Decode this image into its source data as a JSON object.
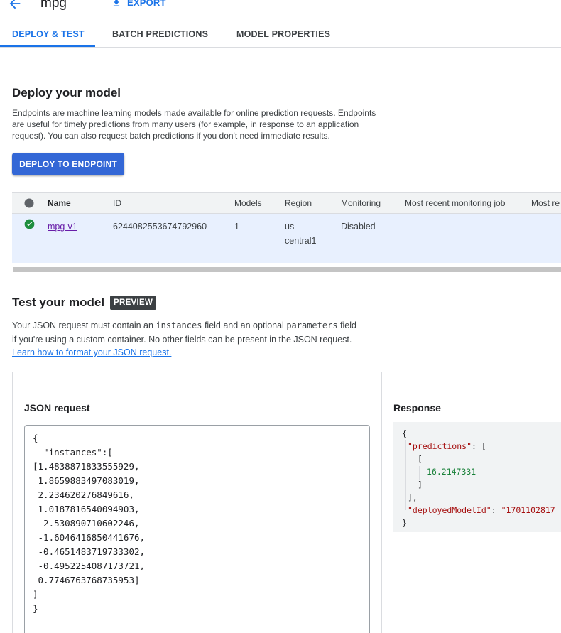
{
  "header": {
    "title": "mpg",
    "export_label": "EXPORT"
  },
  "tabs": [
    {
      "label": "DEPLOY & TEST",
      "active": true
    },
    {
      "label": "BATCH PREDICTIONS",
      "active": false
    },
    {
      "label": "MODEL PROPERTIES",
      "active": false
    }
  ],
  "deploy": {
    "heading": "Deploy your model",
    "description_lines": [
      "Endpoints are machine learning models made available for online prediction requests. Endpoints",
      "are useful for timely predictions from many users (for example, in response to an application",
      "request). You can also request batch predictions if you don't need immediate results."
    ],
    "button_label": "DEPLOY TO ENDPOINT"
  },
  "endpoints_table": {
    "columns": [
      "Name",
      "ID",
      "Models",
      "Region",
      "Monitoring",
      "Most recent monitoring job",
      "Most re"
    ],
    "rows": [
      {
        "status": "ok",
        "name": "mpg-v1",
        "id": "6244082553674792960",
        "models": "1",
        "region_line1": "us-",
        "region_line2": "central1",
        "monitoring": "Disabled",
        "recent_job": "—",
        "most_recent": "—"
      }
    ]
  },
  "test": {
    "heading": "Test your model",
    "badge": "PREVIEW",
    "desc": {
      "part1": "Your JSON request must contain an ",
      "code1": "instances",
      "part2": " field and an optional ",
      "code2": "parameters",
      "part3": " field",
      "line2": "if you're using a custom container. No other fields can be present in the JSON request."
    },
    "learn_link": "Learn how to format your JSON request.",
    "json_request_label": "JSON request",
    "json_request_text": "{\n  \"instances\":[\n[1.4838871833555929,\n 1.8659883497083019,\n 2.234620276849616,\n 1.0187816540094903,\n -2.530890710602246,\n -1.6046416850441676,\n -0.4651483719733302,\n -0.4952254087173721,\n 0.7746763768735953]\n]\n}",
    "response_label": "Response",
    "response": {
      "open_brace": "{",
      "predictions_key": "\"predictions\"",
      "prediction_value": "16.2147331",
      "deployed_key": "\"deployedModelId\"",
      "deployed_value": "\"1701102817",
      "close_brace": "}"
    }
  },
  "colors": {
    "accent": "#1a73e8",
    "button": "#3367d6",
    "success": "#1e8e3e",
    "link_visited": "#681da8"
  }
}
